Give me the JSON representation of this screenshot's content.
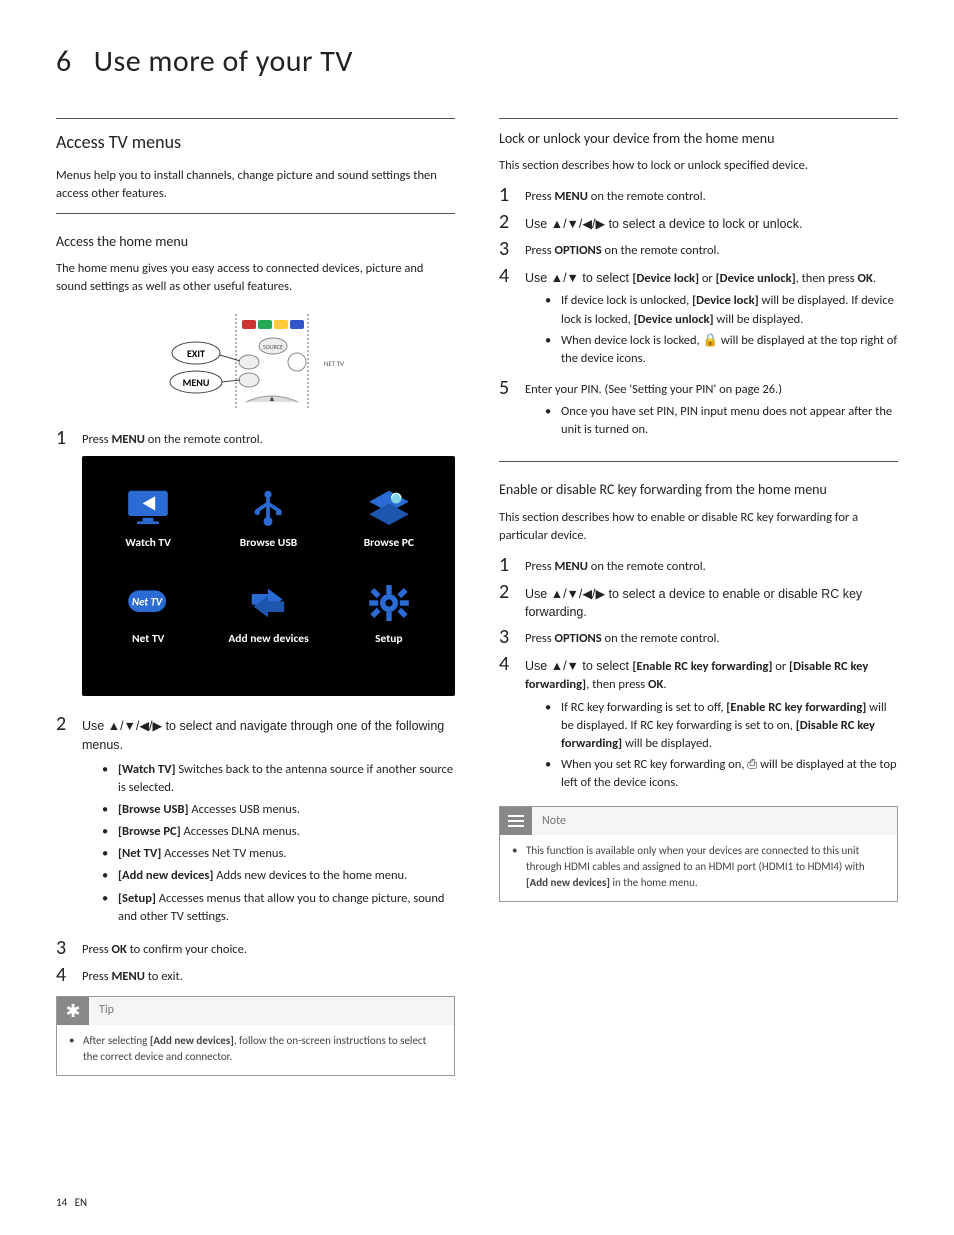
{
  "page": {
    "number": "14",
    "lang": "EN"
  },
  "chapter": {
    "number": "6",
    "title": "Use more of your TV"
  },
  "left": {
    "h2": "Access TV menus",
    "intro": "Menus help you to install channels, change picture and sound settings then access other features.",
    "h3a": "Access the home menu",
    "p_a": "The home menu gives you easy access to connected devices, picture and sound settings as well as other useful features.",
    "remote_labels": {
      "exit": "EXIT",
      "menu": "MENU",
      "source": "SOURCE",
      "nettv": "NET TV"
    },
    "steps": {
      "s1_pre": "Press ",
      "s1_b": "MENU",
      "s1_post": " on the remote control.",
      "s2": "Use ▲/▼/◀/▶ to select and navigate through one of the following menus.",
      "opts": {
        "watch_b": "[Watch TV]",
        "watch_t": " Switches back to the antenna source if another source is selected.",
        "usb_b": "[Browse USB]",
        "usb_t": " Accesses USB menus.",
        "pc_b": "[Browse PC]",
        "pc_t": " Accesses DLNA menus.",
        "net_b": "[Net TV]",
        "net_t": " Accesses Net TV menus.",
        "add_b": "[Add new devices]",
        "add_t": " Adds new devices to the home menu.",
        "setup_b": "[Setup]",
        "setup_t": " Accesses menus that allow you to change picture, sound and other TV settings."
      },
      "s3_pre": "Press ",
      "s3_b": "OK",
      "s3_post": " to confirm your choice.",
      "s4_pre": "Press ",
      "s4_b": "MENU",
      "s4_post": " to exit."
    },
    "tiles": {
      "watch": "Watch TV",
      "usb": "Browse USB",
      "pc": "Browse PC",
      "net": "Net TV",
      "add": "Add new devices",
      "setup": "Setup"
    },
    "tip_label": "Tip",
    "tip_pre": "After selecting ",
    "tip_b": "[Add new devices]",
    "tip_post": ", follow the on-screen instructions to select the correct device and connector."
  },
  "right": {
    "h3a": "Lock or unlock your device from the home menu",
    "p_a": "This section describes how to lock or unlock specified device.",
    "a": {
      "s1_pre": "Press ",
      "s1_b": "MENU",
      "s1_post": " on the remote control.",
      "s2": "Use ▲/▼/◀/▶ to select a device to lock or unlock.",
      "s3_pre": "Press ",
      "s3_b": "OPTIONS",
      "s3_post": " on the remote control.",
      "s4_pre": "Use ▲/▼ to select ",
      "s4_b1": "[Device lock]",
      "s4_mid": " or ",
      "s4_b2": "[Device unlock]",
      "s4_post": ", then press ",
      "s4_b3": "OK",
      "s4_end": ".",
      "s4_sub1_pre": "If device lock is unlocked, ",
      "s4_sub1_b": "[Device lock]",
      "s4_sub1_mid": " will be displayed. If device lock is locked, ",
      "s4_sub1_b2": "[Device unlock]",
      "s4_sub1_post": " will be displayed.",
      "s4_sub2": "When device lock is locked, 🔒 will be displayed at the top right of the device icons.",
      "s5": "Enter your PIN. (See 'Setting your PIN' on page 26.)",
      "s5_sub": "Once you have set PIN, PIN input menu does not appear after the unit is turned on."
    },
    "h3b": "Enable or disable RC key forwarding from the home menu",
    "p_b": "This section describes how to enable or disable RC key forwarding for a particular device.",
    "b": {
      "s1_pre": "Press ",
      "s1_b": "MENU",
      "s1_post": " on the remote control.",
      "s2": "Use ▲/▼/◀/▶ to select a device to enable or disable RC key forwarding.",
      "s3_pre": "Press ",
      "s3_b": "OPTIONS",
      "s3_post": " on the remote control.",
      "s4_pre": "Use ▲/▼ to select ",
      "s4_b1": "[Enable RC key forwarding]",
      "s4_mid": " or ",
      "s4_b2": "[Disable RC key forwarding]",
      "s4_post": ", then press ",
      "s4_b3": "OK",
      "s4_end": ".",
      "s4_sub1_pre": "If RC key forwarding is set to off, ",
      "s4_sub1_b": "[Enable RC key forwarding]",
      "s4_sub1_mid": " will be displayed. If RC key forwarding is set to on, ",
      "s4_sub1_b2": "[Disable RC key forwarding]",
      "s4_sub1_post": " will be displayed.",
      "s4_sub2": "When you set RC key forwarding on, ⎙ will be displayed at the top left of the device icons."
    },
    "note_label": "Note",
    "note_pre": "This function is available only when your devices are connected to this unit through HDMI cables and assigned to an HDMI port (HDMI1 to HDMI4) with ",
    "note_b": "[Add new devices]",
    "note_post": " in the home menu."
  }
}
